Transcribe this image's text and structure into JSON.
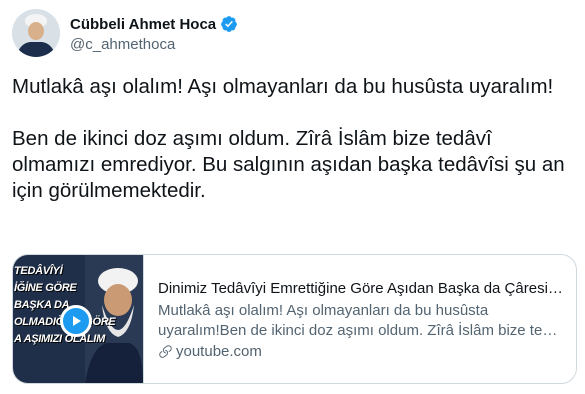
{
  "author": {
    "display_name": "Cübbeli Ahmet Hoca",
    "handle": "@c_ahmethoca",
    "verified": true
  },
  "tweet": {
    "text": "Mutlakâ aşı olalım! Aşı olmayanları da bu husûsta uyaralım!\n\nBen de ikinci doz aşımı oldum. Zîrâ İslâm bize tedâvî olmamızı emrediyor. Bu salgının aşıdan başka tedâvîsi şu an için görülmemektedir."
  },
  "card": {
    "thumbnail_text": [
      "TEDÂVÎYİ",
      "İĞİNE GÖRE",
      "BAŞKA DA",
      "OLMADIĞINA GÖRE",
      "A AŞIMIZI OLALIM"
    ],
    "title": "Dinimiz Tedâvîyi Emrettiğine Göre Aşıdan Başka da Çâresi Ol...",
    "description_line1": "Mutlakâ aşı olalım! Aşı olmayanları da bu husûsta",
    "description_line2": "uyaralım!Ben de ikinci doz aşımı oldum. Zîrâ İslâm bize tedâ...",
    "domain": "youtube.com"
  },
  "colors": {
    "accent": "#1d9bf0",
    "text_primary": "#0f1419",
    "text_secondary": "#536471",
    "border": "#cfd9de"
  },
  "icons": [
    "verified-badge-icon",
    "play-icon",
    "link-icon"
  ]
}
